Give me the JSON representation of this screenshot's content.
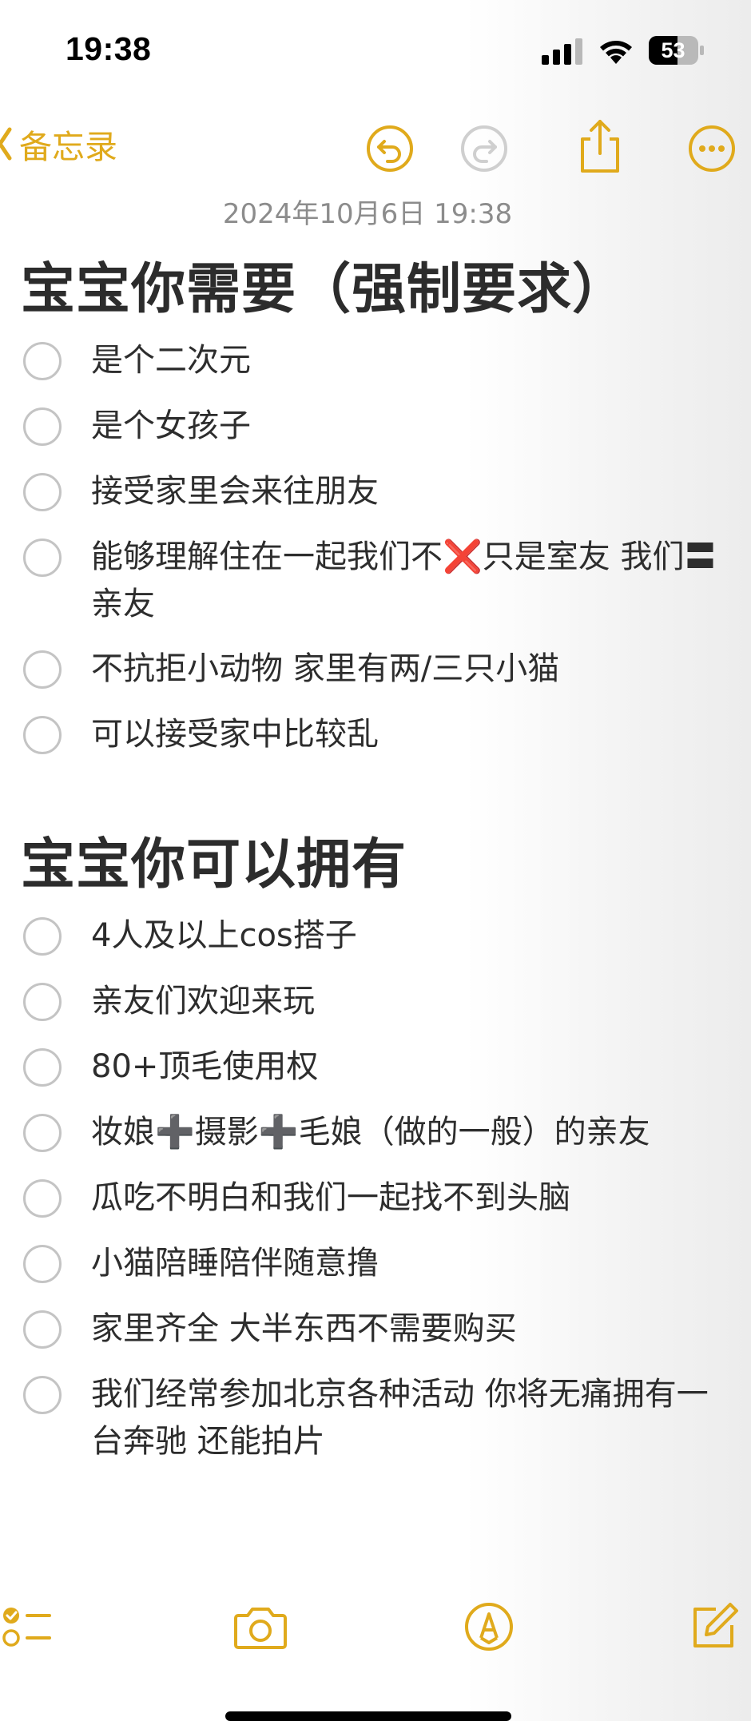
{
  "status_bar": {
    "time": "19:38",
    "battery_level": "53",
    "icons": [
      "signal-icon",
      "wifi-icon",
      "battery-icon"
    ]
  },
  "nav": {
    "back_label": "备忘录",
    "icons": [
      "chevron-left-icon",
      "undo-icon",
      "redo-icon",
      "share-icon",
      "more-icon"
    ]
  },
  "note": {
    "date": "2024年10月6日 19:38",
    "sections": [
      {
        "title": "宝宝你需要（强制要求）",
        "items": [
          "是个二次元",
          "是个女孩子",
          "接受家里会来往朋友",
          "能够理解住在一起我们不❌只是室友 我们〓亲友",
          "不抗拒小动物 家里有两/三只小猫",
          "可以接受家中比较乱"
        ]
      },
      {
        "title": "宝宝你可以拥有",
        "items": [
          "4人及以上cos搭子",
          "亲友们欢迎来玩",
          "80+顶毛使用权",
          "妆娘➕摄影➕毛娘（做的一般）的亲友",
          "瓜吃不明白和我们一起找不到头脑",
          "小猫陪睡陪伴随意撸",
          "家里齐全 大半东西不需要购买",
          "我们经常参加北京各种活动 你将无痛拥有一台奔驰 还能拍片"
        ]
      }
    ]
  },
  "toolbar": {
    "icons": [
      "checklist-icon",
      "camera-icon",
      "markup-icon",
      "compose-icon"
    ]
  },
  "colors": {
    "accent": "#e0aa1c",
    "heading": "#2c2c2c",
    "date": "#8c8c8c",
    "checkbox_border": "#c4c4c4"
  }
}
